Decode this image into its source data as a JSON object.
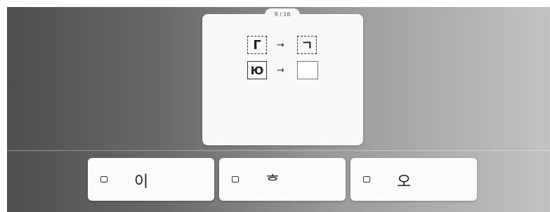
{
  "question": {
    "counter": "9 / 16",
    "example": {
      "source": "Г",
      "target": "ㄱ"
    },
    "prompt": {
      "source": "Ю"
    }
  },
  "options": [
    {
      "glyph": "이"
    },
    {
      "glyph": "ᄒ"
    },
    {
      "glyph": "오"
    }
  ]
}
